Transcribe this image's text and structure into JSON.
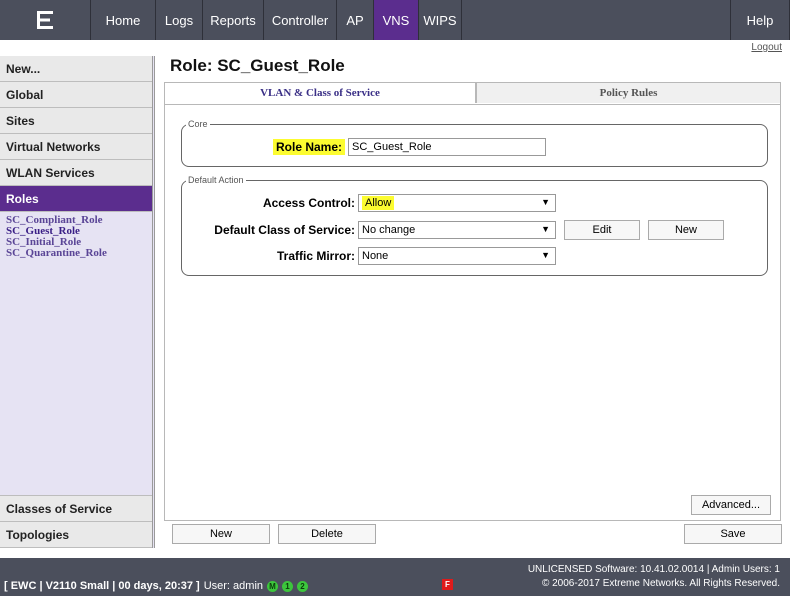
{
  "nav": {
    "items": [
      {
        "label": "Home"
      },
      {
        "label": "Logs"
      },
      {
        "label": "Reports"
      },
      {
        "label": "Controller"
      },
      {
        "label": "AP"
      },
      {
        "label": "VNS"
      },
      {
        "label": "WIPS"
      }
    ],
    "active": "VNS",
    "help": "Help",
    "logout": "Logout"
  },
  "sidebar": {
    "sections": [
      "New...",
      "Global",
      "Sites",
      "Virtual Networks",
      "WLAN Services",
      "Roles"
    ],
    "roles": [
      "SC_Compliant_Role",
      "SC_Guest_Role",
      "SC_Initial_Role",
      "SC_Quarantine_Role"
    ],
    "bottom": [
      "Classes of Service",
      "Topologies"
    ]
  },
  "page": {
    "title": "Role: SC_Guest_Role",
    "tabs": [
      "VLAN & Class of Service",
      "Policy Rules"
    ]
  },
  "core": {
    "legend": "Core",
    "role_name_label": "Role Name:",
    "role_name_value": "SC_Guest_Role"
  },
  "default_action": {
    "legend": "Default Action",
    "access_control_label": "Access Control:",
    "access_control_value": "Allow",
    "cos_label": "Default Class of Service:",
    "cos_value": "No change",
    "edit_label": "Edit",
    "new_label": "New",
    "mirror_label": "Traffic Mirror:",
    "mirror_value": "None"
  },
  "buttons": {
    "advanced": "Advanced...",
    "new": "New",
    "delete": "Delete",
    "save": "Save"
  },
  "status": {
    "left": "[ EWC | V2110 Small | 00 days, 20:37 ]",
    "user": "User: admin",
    "badges": [
      "M",
      "1",
      "2"
    ],
    "flag": "F",
    "right_line1": "UNLICENSED Software: 10.41.02.0014 | Admin Users: 1",
    "right_line2": "© 2006-2017  Extreme Networks. All Rights Reserved."
  },
  "colors": {
    "topbar": "#4b4f5c",
    "accent": "#5b2d8e",
    "highlight": "#fcfc30",
    "sidebar_bg": "#e6e3f3"
  }
}
